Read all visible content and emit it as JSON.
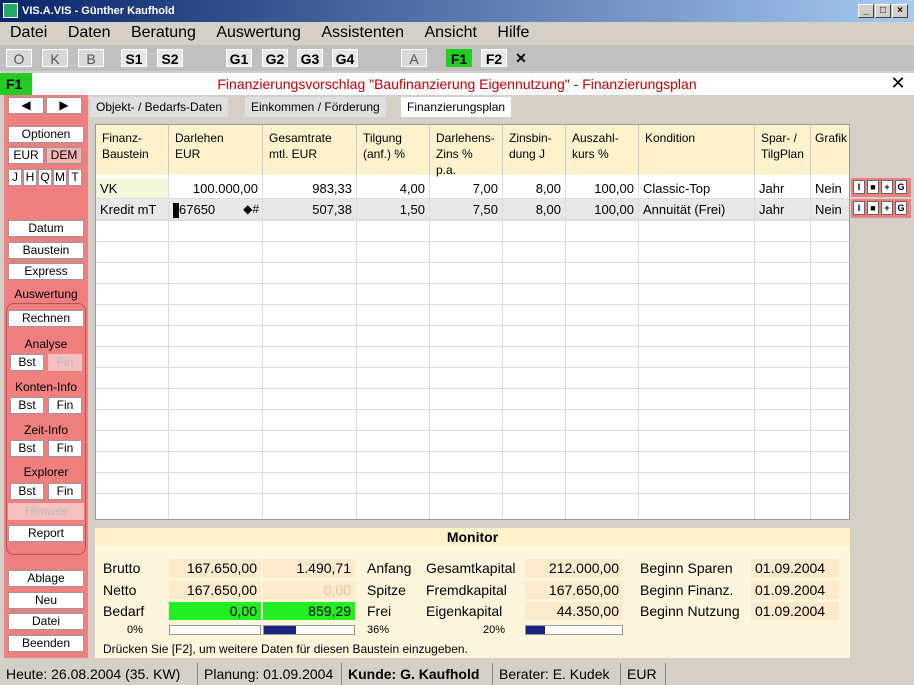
{
  "window": {
    "title": "VIS.A.VIS - Günther Kaufhold"
  },
  "menu": [
    "Datei",
    "Daten",
    "Beratung",
    "Auswertung",
    "Assistenten",
    "Ansicht",
    "Hilfe"
  ],
  "toolbar": [
    "O",
    "K",
    "B",
    "S1",
    "S2",
    "G1",
    "G2",
    "G3",
    "G4",
    "A",
    "F1",
    "F2",
    "✕"
  ],
  "header": {
    "f1": "F1",
    "title": "Finanzierungsvorschlag \"Baufinanzierung Eigennutzung\" - Finanzierungsplan",
    "close": "✕"
  },
  "sidebar": {
    "nav_prev": "◀",
    "nav_next": "▶",
    "optionen": "Optionen",
    "eur": "EUR",
    "dem": "DEM",
    "periods": [
      "J",
      "H",
      "Q",
      "M",
      "T"
    ],
    "datum": "Datum",
    "baustein": "Baustein",
    "express": "Express",
    "auswertung": "Auswertung",
    "rechnen": "Rechnen",
    "analyse": "Analyse",
    "konten": "Konten-Info",
    "zeit": "Zeit-Info",
    "explorer": "Explorer",
    "bst": "Bst",
    "fin": "Fin",
    "hinweis": "Hinweis",
    "report": "Report",
    "ablage": "Ablage",
    "neu": "Neu",
    "datei": "Datei",
    "beenden": "Beenden"
  },
  "tabs": [
    "Objekt- / Bedarfs-Daten",
    "Einkommen / Förderung",
    "Finanzierungsplan"
  ],
  "table": {
    "headers": [
      [
        "Finanz-",
        "Baustein"
      ],
      [
        "Darlehen",
        "EUR"
      ],
      [
        "Gesamtrate",
        "mtl. EUR"
      ],
      [
        "Tilgung",
        "(anf.) %"
      ],
      [
        "Darlehens-",
        "Zins % p.a."
      ],
      [
        "Zinsbin-",
        "dung J"
      ],
      [
        "Auszahl-",
        "kurs %"
      ],
      [
        "Kondition",
        ""
      ],
      [
        "Spar- /",
        "TilgPlan"
      ],
      [
        "Grafik",
        ""
      ]
    ],
    "rows": [
      [
        "VK",
        "100.000,00",
        "983,33",
        "4,00",
        "7,00",
        "8,00",
        "100,00",
        "Classic-Top",
        "Jahr",
        "Nein"
      ],
      [
        "Kredit mT",
        "67650",
        "507,38",
        "1,50",
        "7,50",
        "8,00",
        "100,00",
        "Annuität  (Frei)",
        "Jahr",
        "Nein"
      ]
    ],
    "edit_marker": "◆#",
    "row_buttons": [
      "I",
      "■",
      "+",
      "G"
    ]
  },
  "monitor": {
    "title": "Monitor",
    "brutto_label": "Brutto",
    "brutto1": "167.650,00",
    "brutto2": "1.490,71",
    "netto_label": "Netto",
    "netto1": "167.650,00",
    "netto2": "0,00",
    "bedarf_label": "Bedarf",
    "bedarf1": "0,00",
    "bedarf2": "859,29",
    "anfang": "Anfang",
    "spitze": "Spitze",
    "frei": "Frei",
    "gesamt_label": "Gesamtkapital",
    "gesamt": "212.000,00",
    "fremd_label": "Fremdkapital",
    "fremd": "167.650,00",
    "eigen_label": "Eigenkapital",
    "eigen": "44.350,00",
    "bsparen_label": "Beginn Sparen",
    "bsparen": "01.09.2004",
    "bfinanz_label": "Beginn Finanz.",
    "bfinanz": "01.09.2004",
    "bnutz_label": "Beginn Nutzung",
    "bnutz": "01.09.2004",
    "pct1": "0%",
    "pct2": "36%",
    "pct3": "20%",
    "bar1_fraction": 0.0,
    "bar2_fraction": 0.36,
    "bar3_fraction": 0.2,
    "hint": "Drücken Sie [F2], um weitere Daten für diesen Baustein einzugeben."
  },
  "status": {
    "heute": "Heute: 26.08.2004 (35. KW)",
    "planung": "Planung: 01.09.2004",
    "kunde": "Kunde: G. Kaufhold",
    "berater": "Berater: E. Kudek",
    "waehrung": "EUR"
  },
  "colors": {
    "accent_green": "#22cc22",
    "sidebar_red": "#f08080",
    "title_red": "#c00000",
    "bar_navy": "#1a237e"
  }
}
